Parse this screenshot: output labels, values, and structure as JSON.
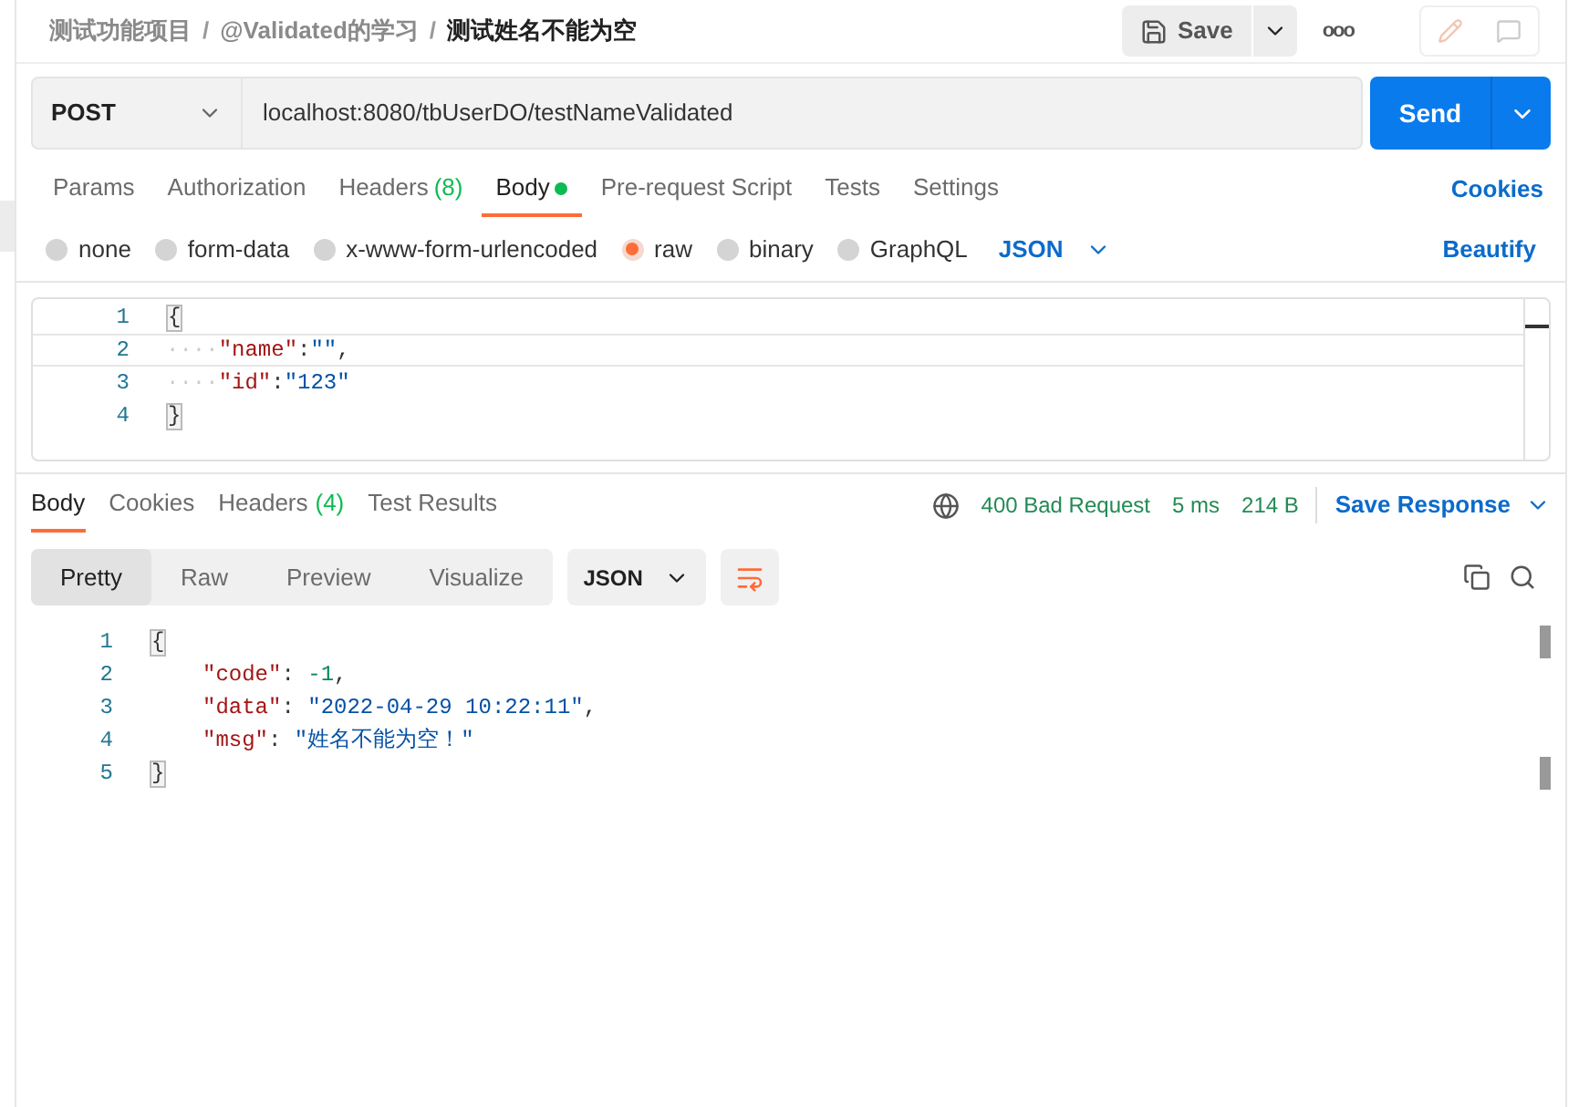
{
  "breadcrumb": [
    {
      "label": "测试功能项目",
      "current": false
    },
    {
      "label": "@Validated的学习",
      "current": false
    },
    {
      "label": "测试姓名不能为空",
      "current": true
    }
  ],
  "breadcrumb_separator": "/",
  "save_button": {
    "label": "Save"
  },
  "more_button": {
    "label": "ooo"
  },
  "request": {
    "method": "POST",
    "url": "localhost:8080/tbUserDO/testNameValidated",
    "send_label": "Send"
  },
  "request_tabs": [
    {
      "label": "Params",
      "selected": false,
      "dot": false
    },
    {
      "label": "Authorization",
      "selected": false,
      "dot": false
    },
    {
      "label": "Headers",
      "count": "(8)",
      "selected": false,
      "dot": false
    },
    {
      "label": "Body",
      "selected": true,
      "dot": true
    },
    {
      "label": "Pre-request Script",
      "selected": false,
      "dot": false
    },
    {
      "label": "Tests",
      "selected": false,
      "dot": false
    },
    {
      "label": "Settings",
      "selected": false,
      "dot": false
    }
  ],
  "cookies_link": "Cookies",
  "body_types": [
    {
      "label": "none",
      "selected": false
    },
    {
      "label": "form-data",
      "selected": false
    },
    {
      "label": "x-www-form-urlencoded",
      "selected": false
    },
    {
      "label": "raw",
      "selected": true
    },
    {
      "label": "binary",
      "selected": false
    },
    {
      "label": "GraphQL",
      "selected": false
    }
  ],
  "raw_format": "JSON",
  "beautify_link": "Beautify",
  "request_body": [
    {
      "number": "1",
      "tokens": [
        {
          "kind": "brace",
          "text": "{"
        }
      ]
    },
    {
      "number": "2",
      "tokens": [
        {
          "kind": "ws",
          "text": "····"
        },
        {
          "kind": "key",
          "text": "\"name\""
        },
        {
          "kind": "punct",
          "text": ":"
        },
        {
          "kind": "string",
          "text": "\"\""
        },
        {
          "kind": "punct",
          "text": ","
        }
      ]
    },
    {
      "number": "3",
      "tokens": [
        {
          "kind": "ws",
          "text": "····"
        },
        {
          "kind": "key",
          "text": "\"id\""
        },
        {
          "kind": "punct",
          "text": ":"
        },
        {
          "kind": "string",
          "text": "\"123\""
        }
      ]
    },
    {
      "number": "4",
      "tokens": [
        {
          "kind": "brace",
          "text": "}"
        }
      ]
    }
  ],
  "response_tabs": [
    {
      "label": "Body",
      "selected": true
    },
    {
      "label": "Cookies",
      "selected": false
    },
    {
      "label": "Headers",
      "count": "(4)",
      "selected": false
    },
    {
      "label": "Test Results",
      "selected": false
    }
  ],
  "response_status": {
    "status": "400 Bad Request",
    "time": "5 ms",
    "size": "214 B",
    "save_label": "Save Response"
  },
  "view_modes": [
    {
      "label": "Pretty",
      "selected": true
    },
    {
      "label": "Raw",
      "selected": false
    },
    {
      "label": "Preview",
      "selected": false
    },
    {
      "label": "Visualize",
      "selected": false
    }
  ],
  "response_format": "JSON",
  "response_body": [
    {
      "number": "1",
      "tokens": [
        {
          "kind": "brace",
          "text": "{"
        }
      ]
    },
    {
      "number": "2",
      "indented": true,
      "tokens": [
        {
          "kind": "key",
          "text": "\"code\""
        },
        {
          "kind": "punct",
          "text": ": "
        },
        {
          "kind": "number",
          "text": "-1"
        },
        {
          "kind": "punct",
          "text": ","
        }
      ]
    },
    {
      "number": "3",
      "indented": true,
      "tokens": [
        {
          "kind": "key",
          "text": "\"data\""
        },
        {
          "kind": "punct",
          "text": ": "
        },
        {
          "kind": "string",
          "text": "\"2022-04-29 10:22:11\""
        },
        {
          "kind": "punct",
          "text": ","
        }
      ]
    },
    {
      "number": "4",
      "indented": true,
      "tokens": [
        {
          "kind": "key",
          "text": "\"msg\""
        },
        {
          "kind": "punct",
          "text": ": "
        },
        {
          "kind": "string",
          "text": "\"姓名不能为空！\""
        }
      ]
    },
    {
      "number": "5",
      "tokens": [
        {
          "kind": "brace",
          "text": "}"
        }
      ]
    }
  ]
}
